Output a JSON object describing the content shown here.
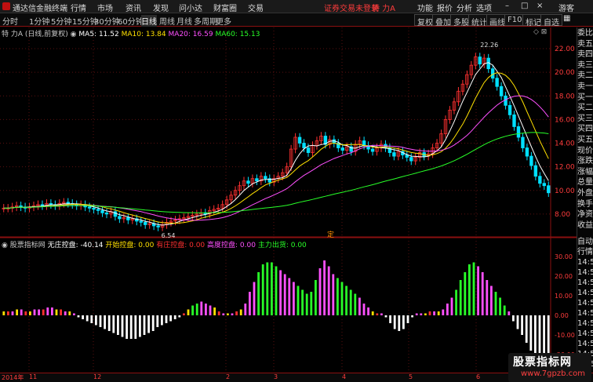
{
  "titlebar": {
    "app_name": "通达信金融终端",
    "menus": [
      "行情",
      "市场",
      "资讯",
      "发现",
      "问小达",
      "财富圈",
      "交易"
    ],
    "notice": "证券交易未登录",
    "stock_short": "特 力A",
    "right_menus": [
      "功能",
      "报价",
      "分析",
      "选项"
    ],
    "guest": "游客",
    "colors": {
      "accent": "#ff3c3c"
    }
  },
  "periods": [
    "分时",
    "1分钟",
    "5分钟",
    "15分钟",
    "30分钟",
    "60分钟",
    "日线",
    "周线",
    "月线",
    "多周期",
    "更多"
  ],
  "active_period": "日线",
  "toolbar_right": [
    "复权",
    "叠加",
    "多股",
    "统计",
    "画线",
    "F10",
    "标记",
    "自选"
  ],
  "main_header": {
    "stock": "特 力A",
    "mode": "(日线,前复权)",
    "ma5": "MA5: 11.52",
    "ma10": "MA10: 13.84",
    "ma20": "MA20: 16.59",
    "ma60": "MA60: 15.13"
  },
  "sub_header": {
    "name": "股票指标网",
    "wz": "无庄控盘: -40.14",
    "kszp": "开始控盘: 0.00",
    "yzkp": "有庄控盘: 0.00",
    "gdkp": "高度控盘: 0.00",
    "zlcc": "主力出货: 0.00"
  },
  "price_axis": [
    "22.00",
    "20.00",
    "18.00",
    "16.00",
    "14.00",
    "12.00",
    "10.00",
    "8.00"
  ],
  "sub_axis": [
    "30.00",
    "20.00",
    "10.00",
    "0.00",
    "-10.00",
    "-20.00"
  ],
  "annotations": {
    "high": "22.26",
    "low": "6.54",
    "ding": "定"
  },
  "x_labels": [
    "2014年",
    "11",
    "12",
    "2",
    "3",
    "4",
    "5",
    "6"
  ],
  "right_panel": [
    "委比",
    "卖五",
    "卖四",
    "卖三",
    "卖二",
    "卖一",
    "买一",
    "买二",
    "买三",
    "买四",
    "买五",
    "现价",
    "涨跌",
    "涨幅",
    "总量",
    "外盘",
    "换手",
    "净资",
    "收益"
  ],
  "right_panel2": [
    "自动",
    "行情",
    "14:56",
    "14:56",
    "14:56",
    "14:56",
    "14:56",
    "14:56",
    "14:56",
    "14:56",
    "14:56",
    "14:56",
    "14:56"
  ],
  "watermark": {
    "line1": "股票指标网",
    "line2": "www.7gpzb.com"
  },
  "chart_data": {
    "type": "candlestick",
    "price_axis": {
      "min": 6,
      "max": 23,
      "ticks": [
        22,
        20,
        18,
        16,
        14,
        12,
        10,
        8
      ]
    },
    "high": 22.26,
    "low": 6.54,
    "closes": [
      8.5,
      8.5,
      8.6,
      8.7,
      8.6,
      8.5,
      8.6,
      8.7,
      8.8,
      8.7,
      8.9,
      8.8,
      8.7,
      8.9,
      9.0,
      8.9,
      8.8,
      8.7,
      8.8,
      8.6,
      8.5,
      8.4,
      8.3,
      8.1,
      8.0,
      8.2,
      7.8,
      7.6,
      7.7,
      7.5,
      7.6,
      7.4,
      7.3,
      7.1,
      7.2,
      7.0,
      6.9,
      7.1,
      7.3,
      7.4,
      7.5,
      7.6,
      7.7,
      7.8,
      7.9,
      8.0,
      8.1,
      8.0,
      8.3,
      8.4,
      8.5,
      8.8,
      9.2,
      9.6,
      10.0,
      10.4,
      10.8,
      10.6,
      11.0,
      10.8,
      11.2,
      11.0,
      10.7,
      11.0,
      11.2,
      11.5,
      12.0,
      13.5,
      14.5,
      14.0,
      13.6,
      13.2,
      13.8,
      14.2,
      14.6,
      13.9,
      14.3,
      14.0,
      13.6,
      13.4,
      13.7,
      13.3,
      13.9,
      14.2,
      13.8,
      13.5,
      13.3,
      13.6,
      13.9,
      13.6,
      13.2,
      12.9,
      13.3,
      13.0,
      12.8,
      12.5,
      12.8,
      13.2,
      12.9,
      13.1,
      13.6,
      14.0,
      14.8,
      16.0,
      16.8,
      17.5,
      18.4,
      19.0,
      19.8,
      20.6,
      21.3,
      20.7,
      21.2,
      20.3,
      19.5,
      18.8,
      18.0,
      17.2,
      16.4,
      15.4,
      14.5,
      13.6,
      12.9,
      12.1,
      11.2,
      10.6,
      10.4,
      9.8
    ],
    "ma_series": [
      {
        "name": "MA5",
        "color": "#ffffff"
      },
      {
        "name": "MA10",
        "color": "#ffe000"
      },
      {
        "name": "MA20",
        "color": "#ff50ff"
      },
      {
        "name": "MA60",
        "color": "#28ff28"
      }
    ],
    "indicator": {
      "axis": {
        "min": -28,
        "max": 34
      },
      "values": [
        2,
        2,
        2,
        3,
        3,
        2,
        2,
        3,
        3,
        3,
        4,
        4,
        3,
        3,
        2,
        2,
        1,
        -1,
        -2,
        -3,
        -4,
        -5,
        -6,
        -7,
        -8,
        -9,
        -10,
        -11,
        -12,
        -12,
        -12,
        -11,
        -10,
        -9,
        -8,
        -6,
        -5,
        -4,
        -3,
        -2,
        -1,
        1,
        3,
        5,
        6,
        7,
        6,
        5,
        4,
        2,
        1,
        1,
        1,
        2,
        3,
        6,
        12,
        17,
        22,
        26,
        27,
        27,
        25,
        23,
        21,
        19,
        17,
        15,
        13,
        11,
        12,
        18,
        24,
        28,
        25,
        21,
        19,
        17,
        15,
        13,
        11,
        9,
        6,
        4,
        2,
        1,
        1,
        -1,
        -4,
        -7,
        -8,
        -7,
        -4,
        -1,
        1,
        1,
        1,
        2,
        2,
        2,
        3,
        6,
        9,
        13,
        18,
        22,
        26,
        27,
        25,
        22,
        18,
        15,
        12,
        9,
        5,
        2,
        -3,
        -7,
        -10,
        -14,
        -18,
        -22,
        -25,
        -28,
        -25
      ]
    }
  }
}
